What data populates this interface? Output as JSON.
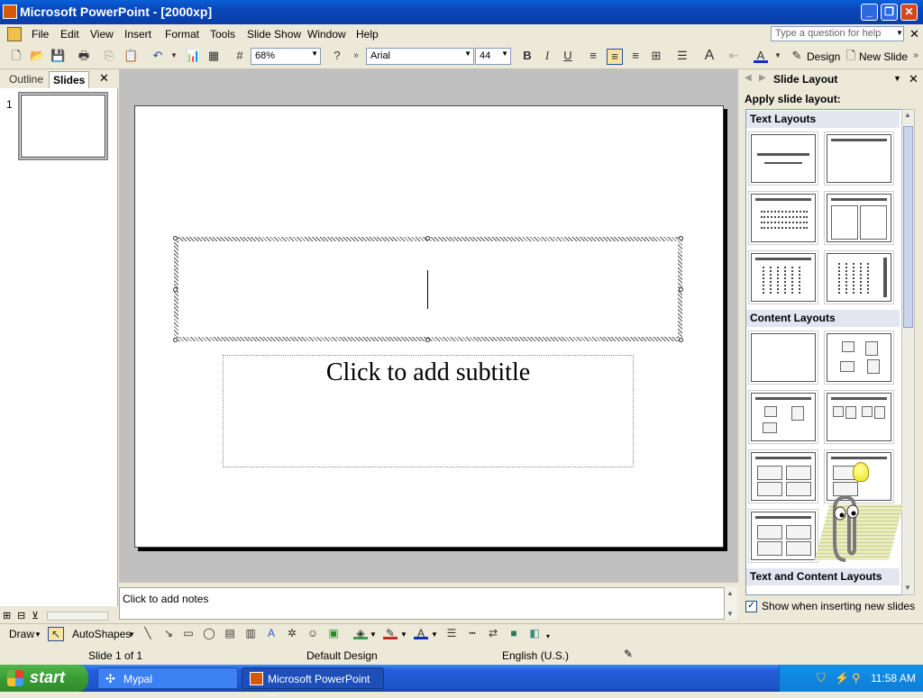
{
  "window": {
    "title": "Microsoft PowerPoint - [2000xp]"
  },
  "menu": [
    "File",
    "Edit",
    "View",
    "Insert",
    "Format",
    "Tools",
    "Slide Show",
    "Window",
    "Help"
  ],
  "help_box": {
    "placeholder": "Type a question for help"
  },
  "toolbar": {
    "zoom": "68%",
    "font": "Arial",
    "font_size": "44",
    "design_label": "Design",
    "new_slide_label": "New Slide"
  },
  "left_tabs": {
    "outline": "Outline",
    "slides": "Slides"
  },
  "slide_number": "1",
  "slide": {
    "subtitle_placeholder": "Click to add subtitle"
  },
  "notes_placeholder": "Click to add notes",
  "task_pane": {
    "title": "Slide Layout",
    "subtitle": "Apply slide layout:",
    "sections": {
      "text": "Text Layouts",
      "content": "Content Layouts",
      "text_content": "Text and Content Layouts"
    },
    "show_checkbox_label": "Show when inserting new slides",
    "show_checked": true
  },
  "drawing": {
    "draw_label": "Draw",
    "autoshapes_label": "AutoShapes"
  },
  "status": {
    "slide": "Slide 1 of 1",
    "design": "Default Design",
    "language": "English (U.S.)"
  },
  "taskbar": {
    "start_label": "start",
    "task1": "Mypal",
    "task2": "Microsoft PowerPoint ...",
    "clock": "11:58 AM"
  }
}
